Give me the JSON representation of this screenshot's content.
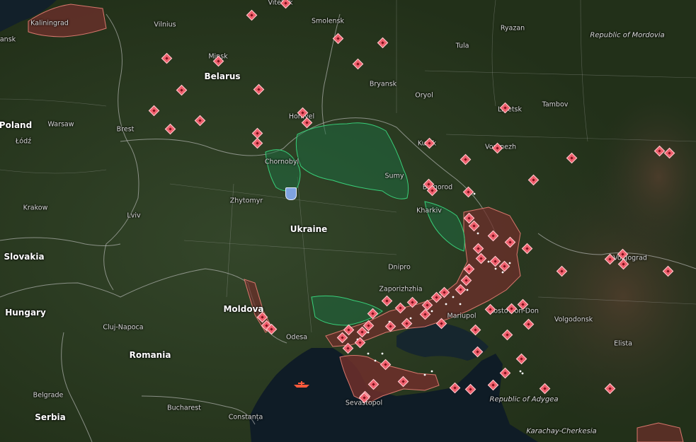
{
  "map": {
    "colors": {
      "land": "#2c3a23",
      "sea": "#0d1a22",
      "occupied_fill": "#6e2f2b",
      "occupied_stroke": "#d8776d",
      "liberated_stroke": "#38d07a",
      "marker_fill": "#f0606e",
      "border": "#c9c9c9"
    },
    "labels": [
      {
        "id": "poland",
        "text": "Poland",
        "kind": "country"
      },
      {
        "id": "belarus",
        "text": "Belarus",
        "kind": "country"
      },
      {
        "id": "ukraine",
        "text": "Ukraine",
        "kind": "country"
      },
      {
        "id": "slovakia",
        "text": "Slovakia",
        "kind": "country"
      },
      {
        "id": "hungary",
        "text": "Hungary",
        "kind": "country"
      },
      {
        "id": "moldova",
        "text": "Moldova",
        "kind": "country"
      },
      {
        "id": "romania",
        "text": "Romania",
        "kind": "country"
      },
      {
        "id": "serbia",
        "text": "Serbia",
        "kind": "country"
      },
      {
        "id": "republic-of-mordovia",
        "text": "Republic of Mordovia",
        "kind": "region"
      },
      {
        "id": "republic-of-adygea",
        "text": "Republic of Adygea",
        "kind": "region"
      },
      {
        "id": "karachay-cherkesia",
        "text": "Karachay-Cherkesia",
        "kind": "region"
      },
      {
        "id": "kaliningrad",
        "text": "Kaliningrad",
        "kind": "city"
      },
      {
        "id": "vilnius",
        "text": "Vilnius",
        "kind": "city"
      },
      {
        "id": "vitebsk",
        "text": "Vitebsk",
        "kind": "city"
      },
      {
        "id": "smolensk",
        "text": "Smolensk",
        "kind": "city"
      },
      {
        "id": "ryazan",
        "text": "Ryazan",
        "kind": "city"
      },
      {
        "id": "tula",
        "text": "Tula",
        "kind": "city"
      },
      {
        "id": "minsk",
        "text": "Minsk",
        "kind": "city"
      },
      {
        "id": "bryansk",
        "text": "Bryansk",
        "kind": "city"
      },
      {
        "id": "oryol",
        "text": "Oryol",
        "kind": "city"
      },
      {
        "id": "lipetsk",
        "text": "Lipetsk",
        "kind": "city"
      },
      {
        "id": "tambov",
        "text": "Tambov",
        "kind": "city"
      },
      {
        "id": "warsaw",
        "text": "Warsaw",
        "kind": "city"
      },
      {
        "id": "lodz",
        "text": "Łódź",
        "kind": "city"
      },
      {
        "id": "brest",
        "text": "Brest",
        "kind": "city"
      },
      {
        "id": "homyel",
        "text": "Homyel",
        "kind": "city"
      },
      {
        "id": "kursk",
        "text": "Kursk",
        "kind": "city"
      },
      {
        "id": "voronezh",
        "text": "Voronezh",
        "kind": "city"
      },
      {
        "id": "chornobyl",
        "text": "Chornobyl",
        "kind": "city"
      },
      {
        "id": "sumy",
        "text": "Sumy",
        "kind": "city"
      },
      {
        "id": "belgorod",
        "text": "Belgorod",
        "kind": "city"
      },
      {
        "id": "zhytomyr",
        "text": "Zhytomyr",
        "kind": "city"
      },
      {
        "id": "kharkiv",
        "text": "Kharkiv",
        "kind": "city"
      },
      {
        "id": "krakow",
        "text": "Krakow",
        "kind": "city"
      },
      {
        "id": "lviv",
        "text": "Lviv",
        "kind": "city"
      },
      {
        "id": "volgograd",
        "text": "Volgograd",
        "kind": "city"
      },
      {
        "id": "dnipro",
        "text": "Dnipro",
        "kind": "city"
      },
      {
        "id": "zaporizhzhia",
        "text": "Zaporizhzhia",
        "kind": "city"
      },
      {
        "id": "mariupol",
        "text": "Mariupol",
        "kind": "city"
      },
      {
        "id": "rostov-on-don",
        "text": "Rostov-on-Don",
        "kind": "city"
      },
      {
        "id": "volgodonsk",
        "text": "Volgodonsk",
        "kind": "city"
      },
      {
        "id": "cluj-napoca",
        "text": "Cluj-Napoca",
        "kind": "city"
      },
      {
        "id": "odesa",
        "text": "Odesa",
        "kind": "city"
      },
      {
        "id": "elista",
        "text": "Elista",
        "kind": "city"
      },
      {
        "id": "belgrade",
        "text": "Belgrade",
        "kind": "city"
      },
      {
        "id": "bucharest",
        "text": "Bucharest",
        "kind": "city"
      },
      {
        "id": "sevastopol",
        "text": "Sevastopol",
        "kind": "city"
      },
      {
        "id": "constanta",
        "text": "Constanța",
        "kind": "city"
      }
    ],
    "partial_labels": [
      {
        "id": "gdansk-fragment",
        "text": "ansk"
      }
    ],
    "icons": {
      "marker": "strike-marker-icon",
      "shield": "kyiv-shield-icon",
      "vessel": "naval-vessel-icon"
    }
  }
}
